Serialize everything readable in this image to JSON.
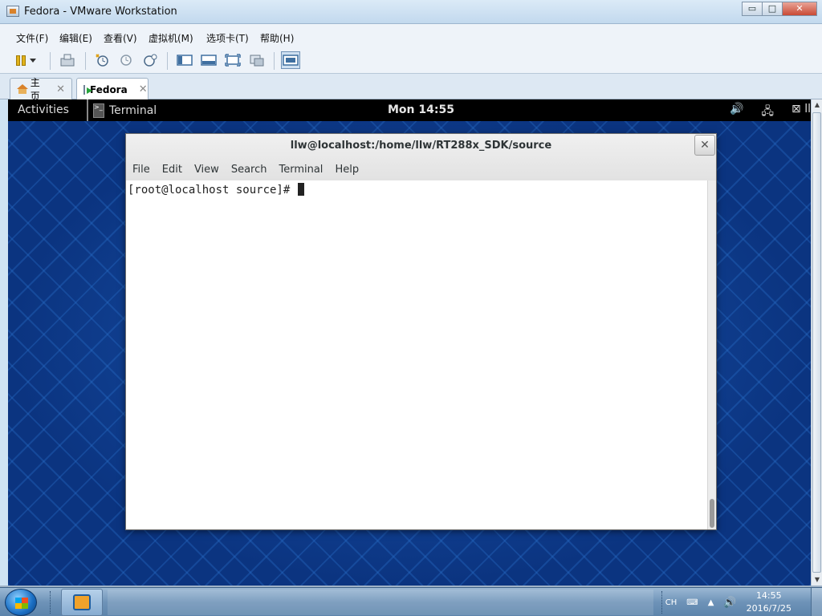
{
  "window": {
    "title": "Fedora - VMware Workstation",
    "min": "▭",
    "max": "□",
    "close": "✕"
  },
  "menu": [
    "文件(F)",
    "编辑(E)",
    "查看(V)",
    "虚拟机(M)",
    "选项卡(T)",
    "帮助(H)"
  ],
  "toolbar_icons": [
    "power-pause-icon",
    "send-ctrl-alt-del-icon",
    "snapshot-take-icon",
    "snapshot-revert-icon",
    "snapshot-manager-icon",
    "console-view-icon",
    "quick-switch-icon",
    "fullscreen-icon",
    "unity-icon",
    "thumbnail-view-icon"
  ],
  "tabs": [
    {
      "label": "主页",
      "icon": "home-icon"
    },
    {
      "label": "Fedora",
      "icon": "vm-icon",
      "active": true
    }
  ],
  "guest": {
    "activities": "Activities",
    "app_name": "Terminal",
    "clock": "Mon 14:55",
    "tray": {
      "volume": "🔊",
      "network": "🖧",
      "user": "ll"
    }
  },
  "terminal": {
    "title": "llw@localhost:/home/llw/RT288x_SDK/source",
    "close": "✕",
    "menu": [
      "File",
      "Edit",
      "View",
      "Search",
      "Terminal",
      "Help"
    ],
    "prompt": "[root@localhost source]# "
  },
  "taskbar": {
    "lang": "CH",
    "time": "14:55",
    "date": "2016/7/25"
  }
}
